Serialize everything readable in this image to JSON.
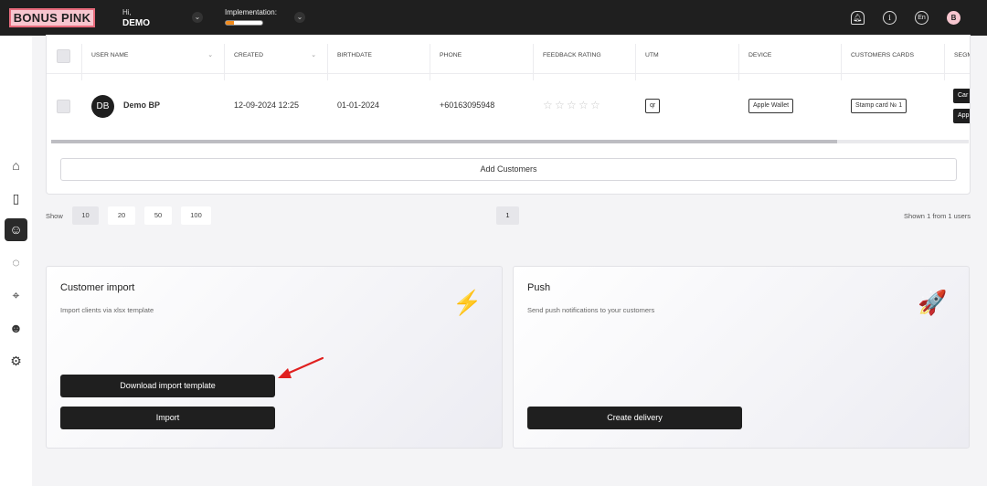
{
  "header": {
    "logo": "BONUS PINK",
    "greeting": "Hi,",
    "user_name": "DEMO",
    "implementation_label": "Implementation:",
    "implementation_progress": 0.22,
    "lang": "En",
    "avatar_letter": "B",
    "icons": [
      "bell-icon",
      "info-icon",
      "language-icon",
      "avatar"
    ]
  },
  "sidebar": {
    "items": [
      {
        "icon": "home-icon",
        "glyph": "⌂"
      },
      {
        "icon": "phone-icon",
        "glyph": "▯"
      },
      {
        "icon": "customers-icon",
        "glyph": "☺",
        "active": true
      },
      {
        "icon": "chat-icon",
        "glyph": "◌"
      },
      {
        "icon": "location-icon",
        "glyph": "⌖"
      },
      {
        "icon": "user-icon",
        "glyph": "☻"
      },
      {
        "icon": "settings-icon",
        "glyph": "⚙"
      }
    ]
  },
  "table": {
    "columns": [
      "USER NAME",
      "CREATED",
      "BIRTHDATE",
      "PHONE",
      "FEEDBACK RATING",
      "UTM",
      "DEVICE",
      "CUSTOMERS CARDS",
      "SEGM"
    ],
    "row": {
      "initials": "DB",
      "name": "Demo BP",
      "created": "12-09-2024 12:25",
      "birthdate": "01-01-2024",
      "phone": "+60163095948",
      "rating": 0,
      "utm": "qr",
      "device": "Apple Wallet",
      "card": "Stamp card № 1",
      "segments": [
        "Car",
        "App"
      ]
    },
    "add_customers": "Add Customers"
  },
  "pagination": {
    "show_label": "Show",
    "sizes": [
      "10",
      "20",
      "50",
      "100"
    ],
    "active_size": "10",
    "current_page": "1",
    "shown_text": "Shown 1 from 1 users"
  },
  "import_panel": {
    "title": "Customer import",
    "description": "Import clients via xlsx template",
    "download_button": "Download import template",
    "import_button": "Import",
    "emoji": "⚡"
  },
  "push_panel": {
    "title": "Push",
    "description": "Send push notifications to your customers",
    "create_button": "Create delivery",
    "emoji": "🚀"
  },
  "colors": {
    "dark": "#1f1f1f",
    "brand_pink": "#f7c6cf",
    "progress": "#f28b1c",
    "annotation_arrow": "#e02020"
  }
}
